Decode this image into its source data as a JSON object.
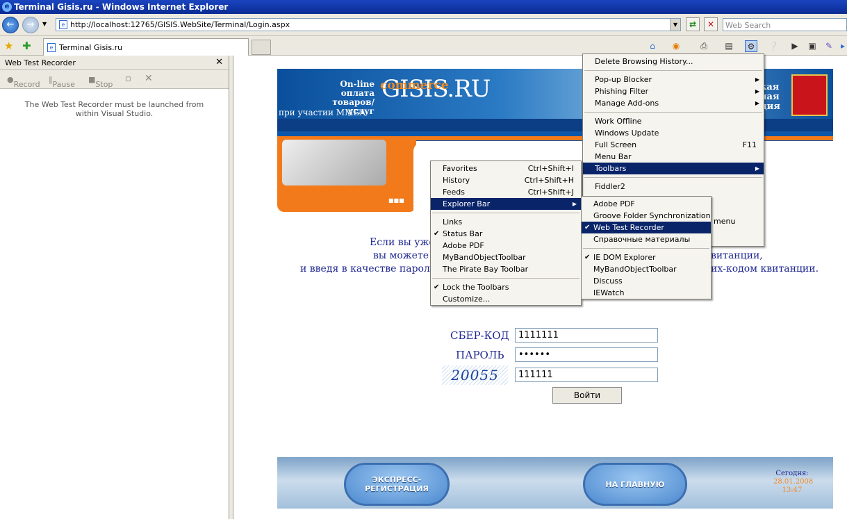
{
  "window": {
    "title": "Terminal Gisis.ru - Windows Internet Explorer"
  },
  "browser": {
    "address": "http://localhost:12765/GISIS.WebSite/Terminal/Login.aspx",
    "search_placeholder": "Web Search",
    "tab_title": "Terminal Gisis.ru"
  },
  "side_panel": {
    "title": "Web Test Recorder",
    "record": "Record",
    "pause": "Pause",
    "stop": "Stop",
    "message": "The Web Test Recorder must be launched from within Visual Studio."
  },
  "banner": {
    "logo": "GISIS.RU",
    "commerce": "commerce",
    "online_line1": "On-line",
    "online_line2": "оплата",
    "online_line3": "товаров/услуг",
    "mmba": "при участии ММБА",
    "right_line1": "кая",
    "right_line2": "ная",
    "right_line3": "ция"
  },
  "page": {
    "info_line1": "Если вы уже",
    "info_line2": "вы можете вой",
    "info_line2_end": "витанции,",
    "info_line3": "и введя в качестве пароля P",
    "info_line3_end": "их-кодом квитанции.",
    "sber_label": "СБЕР-КОД",
    "sber_value": "1111111",
    "password_label": "ПАРОЛЬ",
    "password_value": "••••••",
    "captcha_text": "20055",
    "captcha_value": "111111",
    "login_button": "Войти"
  },
  "footer": {
    "express_line1": "ЭКСПРЕСС-",
    "express_line2": "РЕГИСТРАЦИЯ",
    "home_button": "НА ГЛАВНУЮ",
    "today_label": "Сегодня:",
    "today_date": "28.01.2008",
    "today_time": "13:47"
  },
  "tools_menu": {
    "items": [
      {
        "label": "Delete Browsing History..."
      },
      {
        "label": "Pop-up Blocker"
      },
      {
        "label": "Phishing Filter"
      },
      {
        "label": "Manage Add-ons"
      },
      {
        "label": "Work Offline"
      },
      {
        "label": "Windows Update"
      },
      {
        "label": "Full Screen",
        "shortcut": "F11"
      },
      {
        "label": "Menu Bar"
      },
      {
        "label": "Toolbars"
      },
      {
        "label": "Fiddler2"
      }
    ],
    "hidden_item_tail": "menu"
  },
  "toolbars_menu": {
    "items": [
      {
        "label": "Favorites",
        "shortcut": "Ctrl+Shift+I"
      },
      {
        "label": "History",
        "shortcut": "Ctrl+Shift+H"
      },
      {
        "label": "Feeds",
        "shortcut": "Ctrl+Shift+J"
      },
      {
        "label": "Explorer Bar"
      },
      {
        "label": "Links"
      },
      {
        "label": "Status Bar"
      },
      {
        "label": "Adobe PDF"
      },
      {
        "label": "MyBandObjectToolbar"
      },
      {
        "label": "The Pirate Bay Toolbar"
      },
      {
        "label": "Lock the Toolbars"
      },
      {
        "label": "Customize..."
      }
    ]
  },
  "explorer_bar_menu": {
    "items": [
      {
        "label": "Adobe PDF"
      },
      {
        "label": "Groove Folder Synchronization"
      },
      {
        "label": "Web Test Recorder"
      },
      {
        "label": "Справочные материалы"
      },
      {
        "label": "IE DOM Explorer"
      },
      {
        "label": "MyBandObjectToolbar"
      },
      {
        "label": "Discuss"
      },
      {
        "label": "IEWatch"
      }
    ]
  },
  "colors": {
    "accent": "#0a246a",
    "brand_orange": "#f27a1a",
    "text_blue": "#1f2790"
  }
}
